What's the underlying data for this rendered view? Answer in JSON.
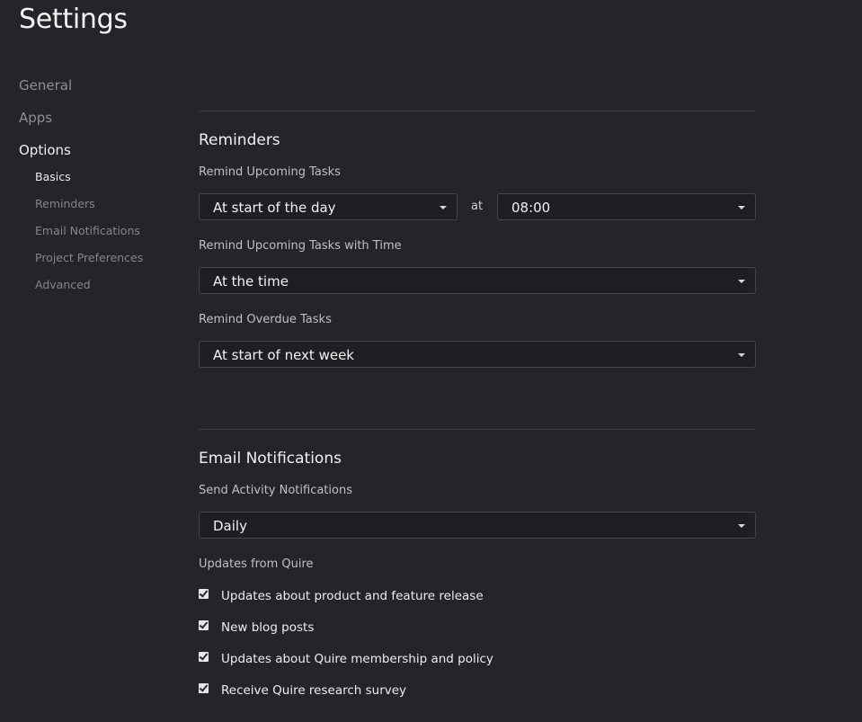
{
  "page": {
    "title": "Settings"
  },
  "nav": {
    "items": [
      {
        "label": "General"
      },
      {
        "label": "Apps"
      },
      {
        "label": "Options"
      }
    ],
    "sub_items": [
      {
        "label": "Basics"
      },
      {
        "label": "Reminders"
      },
      {
        "label": "Email Notifications"
      },
      {
        "label": "Project Preferences"
      },
      {
        "label": "Advanced"
      }
    ],
    "active_item": "Options",
    "active_sub_item": "Basics"
  },
  "reminders": {
    "title": "Reminders",
    "upcoming": {
      "label": "Remind Upcoming Tasks",
      "value": "At start of the day",
      "at_label": "at",
      "time_value": "08:00"
    },
    "upcoming_with_time": {
      "label": "Remind Upcoming Tasks with Time",
      "value": "At the time"
    },
    "overdue": {
      "label": "Remind Overdue Tasks",
      "value": "At start of next week"
    }
  },
  "email_notifications": {
    "title": "Email Notifications",
    "activity": {
      "label": "Send Activity Notifications",
      "value": "Daily"
    },
    "updates_label": "Updates from Quire",
    "updates": [
      {
        "label": "Updates about product and feature release",
        "checked": true
      },
      {
        "label": "New blog posts",
        "checked": true
      },
      {
        "label": "Updates about Quire membership and policy",
        "checked": true
      },
      {
        "label": "Receive Quire research survey",
        "checked": true
      }
    ]
  },
  "colors": {
    "background": "#242529",
    "select_background": "#1e1f22",
    "border": "#45464b",
    "text": "#f2f2f2",
    "muted_text": "#8e8f94"
  }
}
